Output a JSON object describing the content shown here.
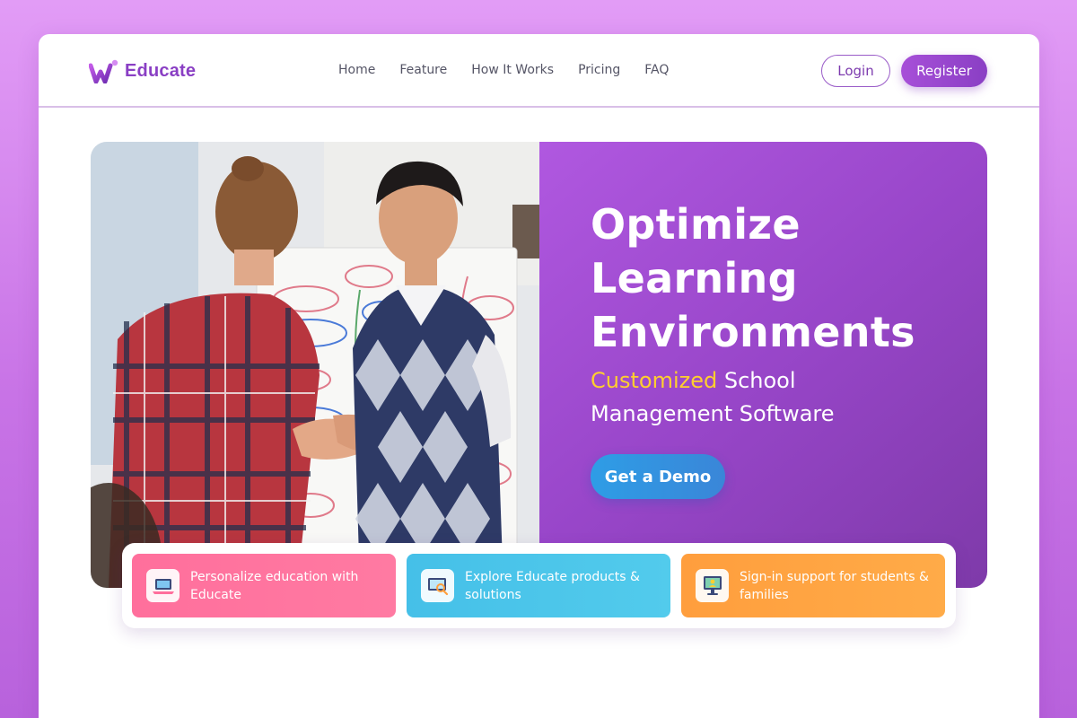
{
  "brand": {
    "name": "Educate"
  },
  "nav": {
    "items": [
      {
        "label": "Home"
      },
      {
        "label": "Feature"
      },
      {
        "label": "How It Works"
      },
      {
        "label": "Pricing"
      },
      {
        "label": "FAQ"
      }
    ],
    "login_label": "Login",
    "register_label": "Register"
  },
  "hero": {
    "title_lines": [
      "Optimize",
      "Learning",
      "Environments"
    ],
    "subtitle_accent": "Customized",
    "subtitle_rest_1": " School",
    "subtitle_line_2": "Management Software",
    "cta_label": "Get a Demo"
  },
  "cards": [
    {
      "text": "Personalize education with Educate",
      "icon": "laptop-icon",
      "color": "#ff6f9c"
    },
    {
      "text": "Explore Educate products & solutions",
      "icon": "search-screen-icon",
      "color": "#45c0e8"
    },
    {
      "text": "Sign-in support for students & families",
      "icon": "monitor-user-icon",
      "color": "#ff9e3d"
    }
  ],
  "colors": {
    "brand": "#8a3fc4",
    "accent_yellow": "#ffcf2e",
    "cta_blue": "#2e9de6"
  }
}
